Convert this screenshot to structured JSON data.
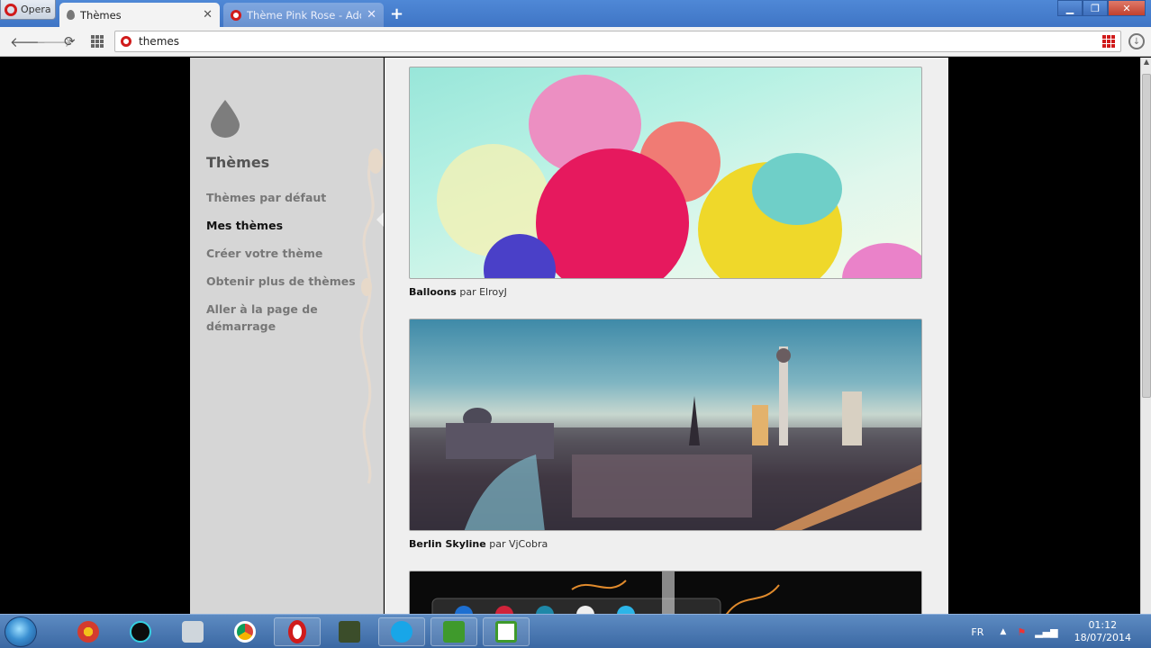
{
  "browser": {
    "menu_button": "Opera",
    "tabs": [
      {
        "label": "Thèmes",
        "active": true
      },
      {
        "label": "Thème Pink Rose - Add-o",
        "active": false
      }
    ],
    "new_tab": "+",
    "address": "themes",
    "window_controls": {
      "minimize": "▁",
      "restore": "❐",
      "close": "✕"
    }
  },
  "sidebar": {
    "title": "Thèmes",
    "items": [
      {
        "label": "Thèmes par défaut",
        "current": false
      },
      {
        "label": "Mes thèmes",
        "current": true
      },
      {
        "label": "Créer votre thème",
        "current": false
      },
      {
        "label": "Obtenir plus de thèmes",
        "current": false
      },
      {
        "label": "Aller à la page de démarrage",
        "current": false
      }
    ]
  },
  "themes": [
    {
      "name": "Balloons",
      "by": "par",
      "author": "ElroyJ"
    },
    {
      "name": "Berlin Skyline",
      "by": "par",
      "author": "VjCobra"
    }
  ],
  "taskbar": {
    "language": "FR",
    "time": "01:12",
    "date": "18/07/2014",
    "apps": [
      "chrome-logo-icon",
      "media-player-icon",
      "scanner-icon",
      "chrome-icon",
      "opera-icon",
      "game-icon",
      "skype-icon",
      "camtasia-icon",
      "camtasia-recorder-icon"
    ]
  },
  "colors": {
    "opera_red": "#d01b1b",
    "tabbar_blue": "#3f75c5",
    "sidebar_bg": "#d6d6d6",
    "main_bg": "#efefef"
  }
}
